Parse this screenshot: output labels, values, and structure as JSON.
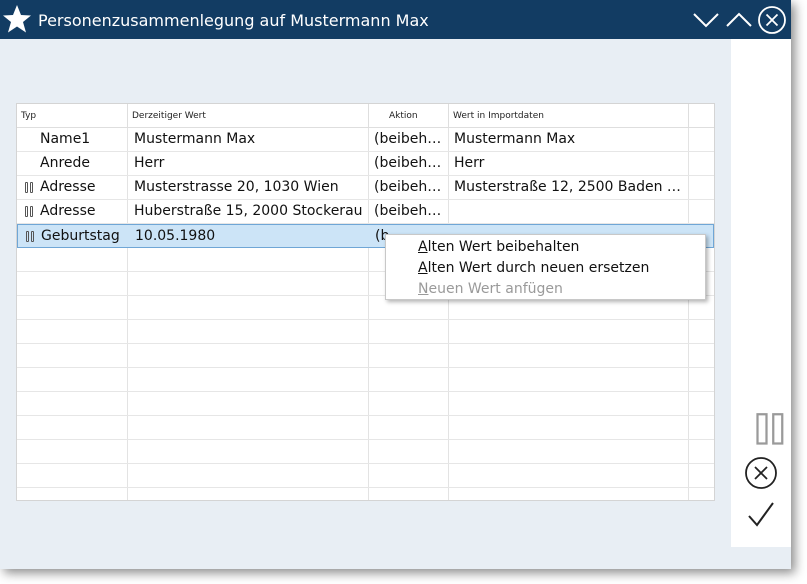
{
  "window": {
    "title": "Personenzusammenlegung auf Mustermann Max",
    "icons": {
      "app": "star-icon",
      "minimize": "chevron-down-icon",
      "maximize": "chevron-up-icon",
      "close": "close-circle-icon"
    }
  },
  "grid": {
    "columns": [
      "Typ",
      "Derzeitiger Wert",
      "Aktion",
      "Wert in Importdaten"
    ],
    "rows": [
      {
        "typ": "Name1",
        "current": "Mustermann Max",
        "action": "(beibeh…",
        "import": "Mustermann Max",
        "grip": false
      },
      {
        "typ": "Anrede",
        "current": "Herr",
        "action": "(beibeh…",
        "import": "Herr",
        "grip": false
      },
      {
        "typ": "Adresse",
        "current": "Musterstrasse 20, 1030 Wien",
        "action": "(beibeh…",
        "import": "Musterstraße 12, 2500 Baden …",
        "grip": true
      },
      {
        "typ": "Adresse",
        "current": "Huberstraße 15, 2000 Stockerau",
        "action": "(beibeh…",
        "import": "",
        "grip": true
      },
      {
        "typ": "Geburtstag",
        "current": "10.05.1980",
        "action": "(b",
        "import": "",
        "grip": true,
        "selected": true
      }
    ]
  },
  "context_menu": {
    "items": [
      {
        "first": "A",
        "rest": "lten Wert beibehalten",
        "disabled": false
      },
      {
        "first": "A",
        "rest": "lten Wert durch neuen ersetzen",
        "disabled": false
      },
      {
        "first": "N",
        "rest": "euen Wert anfügen",
        "disabled": true
      }
    ]
  },
  "right_panel": {
    "icons": {
      "drag": "grip-icon",
      "cancel": "cancel-circle-icon",
      "confirm": "checkmark-icon"
    }
  }
}
